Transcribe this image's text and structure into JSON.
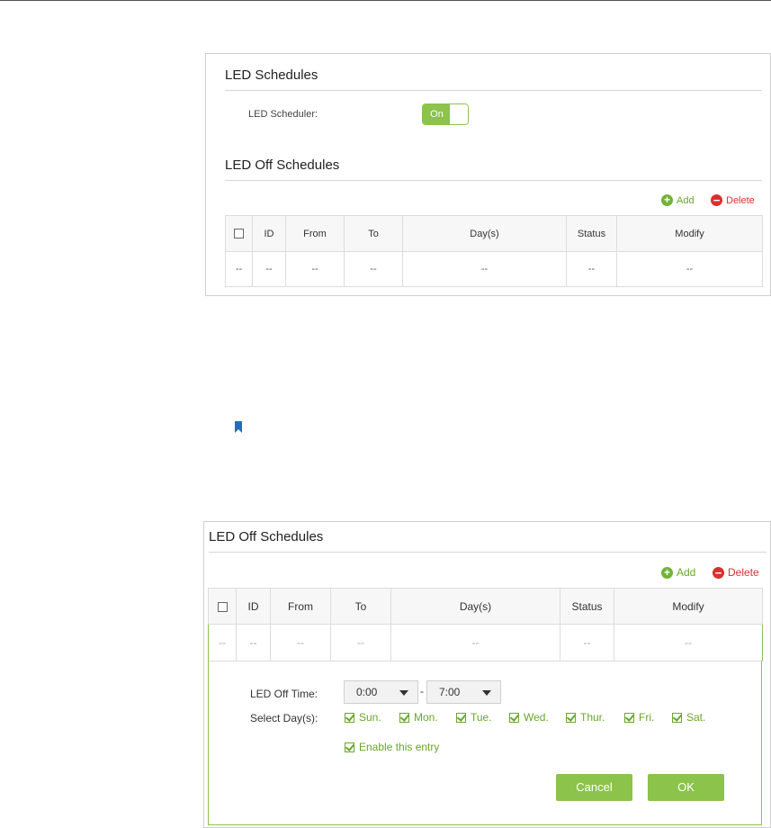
{
  "led_schedules": {
    "title": "LED Schedules",
    "scheduler_label": "LED Scheduler:",
    "toggle_label": "On"
  },
  "led_off_schedules": {
    "title": "LED Off Schedules",
    "add_label": "Add",
    "delete_label": "Delete",
    "columns": [
      "ID",
      "From",
      "To",
      "Day(s)",
      "Status",
      "Modify"
    ],
    "row": [
      "--",
      "--",
      "--",
      "--",
      "--",
      "--",
      "--"
    ]
  },
  "editor": {
    "title": "LED Off Schedules",
    "add_label": "Add",
    "delete_label": "Delete",
    "columns": [
      "ID",
      "From",
      "To",
      "Day(s)",
      "Status",
      "Modify"
    ],
    "row": [
      "--",
      "--",
      "--",
      "--",
      "--",
      "--",
      "--"
    ],
    "off_time_label": "LED Off Time:",
    "from_value": "0:00",
    "separator": "-",
    "to_value": "7:00",
    "select_days_label": "Select Day(s):",
    "days": [
      "Sun.",
      "Mon.",
      "Tue.",
      "Wed.",
      "Thur.",
      "Fri.",
      "Sat."
    ],
    "enable_label": "Enable this entry",
    "cancel_label": "Cancel",
    "ok_label": "OK"
  },
  "colors": {
    "accent_green": "#8cc34a",
    "add_green": "#72b338",
    "delete_red": "#d9302f",
    "note_blue": "#1f6fc0"
  },
  "icons": [
    "add-icon",
    "delete-icon",
    "checkbox-icon",
    "dropdown-arrow-icon",
    "bookmark-icon"
  ]
}
